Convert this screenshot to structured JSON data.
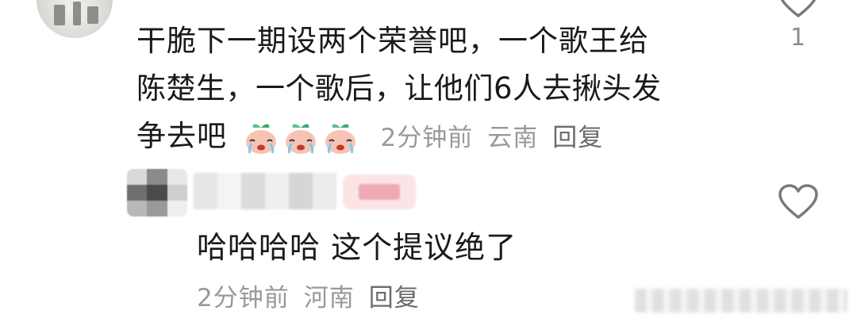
{
  "comment1": {
    "text_lines": [
      "干脆下一期设两个荣誉吧，一个歌王给",
      "陈楚生，一个歌后，让他们6人去揪头发",
      "争去吧"
    ],
    "emojis": [
      "crying-peach-emoji",
      "crying-peach-emoji",
      "crying-peach-emoji"
    ],
    "time": "2分钟前",
    "location": "云南",
    "reply_label": "回复",
    "like_count": "1"
  },
  "comment2": {
    "text": "哈哈哈哈 这个提议绝了",
    "time": "2分钟前",
    "location": "河南",
    "reply_label": "回复"
  },
  "colors": {
    "text": "#1a1a1a",
    "meta": "#999999",
    "icon": "#7a7a7a"
  }
}
